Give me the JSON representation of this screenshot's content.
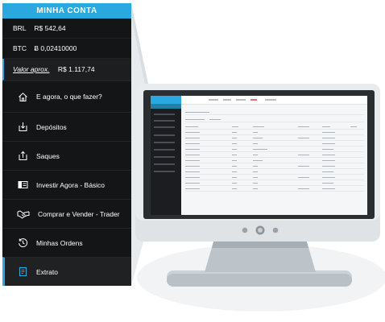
{
  "sidebar": {
    "header": "MINHA CONTA",
    "balances": [
      {
        "currency": "BRL",
        "value": "R$ 542,64"
      },
      {
        "currency": "BTC",
        "value": "Ƀ 0,02410000"
      }
    ],
    "approx": {
      "label": "Valor aprox.",
      "value": "R$ 1.117,74"
    },
    "items": [
      {
        "label": "E agora, o que fazer?",
        "icon": "home-icon"
      },
      {
        "label": "Depósitos",
        "icon": "deposit-icon"
      },
      {
        "label": "Saques",
        "icon": "withdraw-icon"
      },
      {
        "label": "Investir Agora - Básico",
        "icon": "invest-icon"
      },
      {
        "label": "Comprar e Vender - Trader",
        "icon": "handshake-icon"
      },
      {
        "label": "Minhas Ordens",
        "icon": "history-icon"
      },
      {
        "label": "Extrato",
        "icon": "statement-icon",
        "active": true
      }
    ]
  },
  "colors": {
    "accent": "#2aa8df",
    "sidebar_bg": "#141516",
    "monitor_frame": "#d6dadd",
    "monitor_bezel": "#2b2e31"
  }
}
